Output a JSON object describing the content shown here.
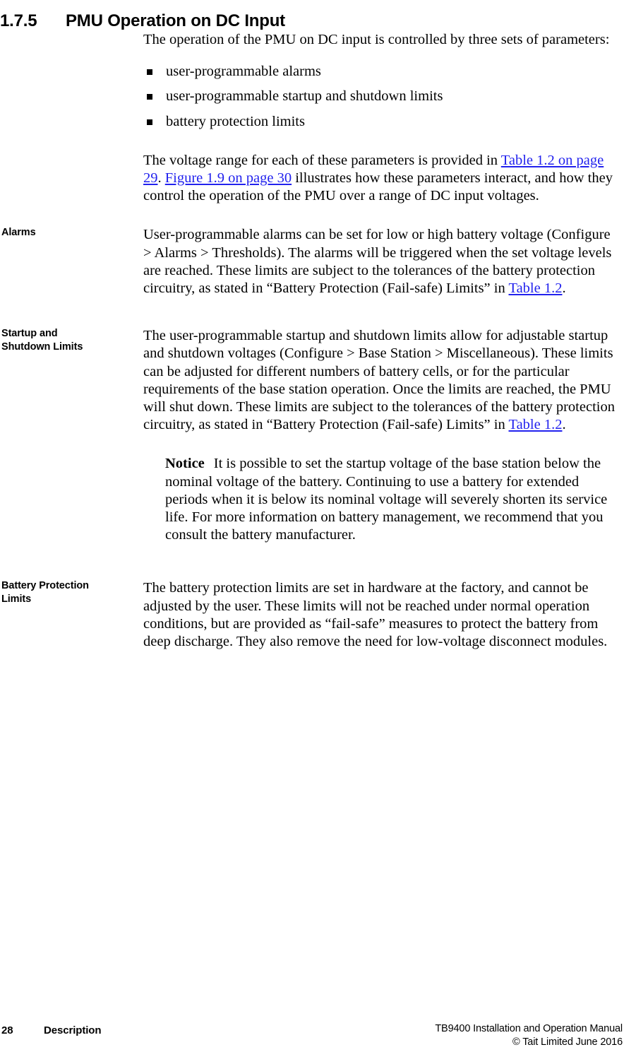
{
  "heading": {
    "number": "1.7.5",
    "title": "PMU Operation on DC Input"
  },
  "intro": {
    "paragraph": "The operation of the PMU on DC input is controlled by three sets of parameters:",
    "bullets": [
      "user-programmable alarms",
      "user-programmable startup and shutdown limits",
      "battery protection limits"
    ]
  },
  "voltage_range_para": {
    "text_1": "The voltage range for each of these parameters is provided in ",
    "link_1": "Table 1.2 on page 29",
    "text_2": ". ",
    "link_2": "Figure 1.9 on page 30",
    "text_3": " illustrates how these parameters interact, and how they control the operation of the PMU over a range of DC input voltages."
  },
  "alarms": {
    "label": "Alarms",
    "text_1": "User-programmable alarms can be set for low or high battery voltage (Configure > Alarms > Thresholds). The alarms will be triggered when the set voltage levels are reached. These limits are subject to the tolerances of the battery protection circuitry, as stated in “Battery Protection (Fail-safe) Limits” in ",
    "link_1": "Table 1.2",
    "text_2": "."
  },
  "startup_shutdown": {
    "label_line_1": "Startup and",
    "label_line_2": "Shutdown Limits",
    "text_1": "The user-programmable startup and shutdown limits allow for adjustable startup and shutdown voltages (Configure > Base Station > Miscellaneous). These limits can be adjusted for different numbers of battery cells, or for the particular requirements of the base station operation. Once the limits are reached, the PMU will shut down. These limits are subject to the tolerances of the battery protection circuitry, as stated in “Battery Protection (Fail-safe) Limits” in ",
    "link_1": "Table 1.2",
    "text_2": "."
  },
  "notice": {
    "word": "Notice",
    "text": "It is possible to set the startup voltage of the base station below the nominal voltage of the battery. Continuing to use a battery for extended periods when it is below its nominal voltage will severely shorten its service life. For more information on battery management, we recommend that you consult the battery manufacturer."
  },
  "battery_protection": {
    "label_line_1": "Battery Protection",
    "label_line_2": "Limits",
    "text": "The battery protection limits are set in hardware at the factory, and cannot be adjusted by the user. These limits will not be reached under normal operation conditions, but are provided as “fail-safe” measures to protect the battery from deep discharge. They also remove the need for low-voltage disconnect modules."
  },
  "footer": {
    "page_number": "28",
    "chapter": "Description",
    "manual": "TB9400 Installation and Operation Manual",
    "copyright": "© Tait Limited June 2016"
  },
  "colors": {
    "link": "#2222ee",
    "text": "#000000",
    "background": "#ffffff"
  }
}
